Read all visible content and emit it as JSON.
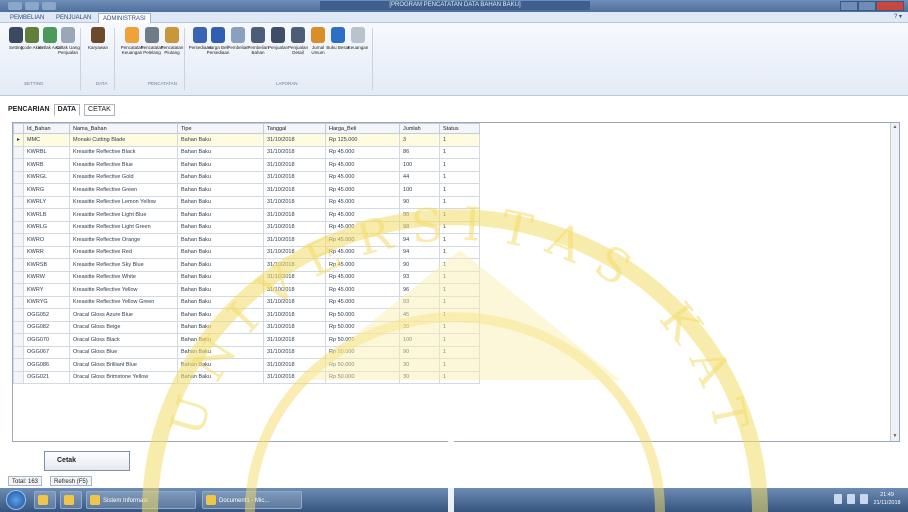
{
  "window": {
    "title": "[PROGRAM PENCATATAN DATA BAHAN BAKU]"
  },
  "menu": {
    "tabs": [
      "PEMBELIAN",
      "PENJUALAN",
      "ADMINISTRASI"
    ],
    "active": "ADMINISTRASI"
  },
  "ribbon": {
    "buttons": [
      {
        "label": "Setting",
        "icon": "user-gear-icon",
        "color": "#3b4a60"
      },
      {
        "label": "Kode Akun",
        "icon": "key-icon",
        "color": "#5f7f3a"
      },
      {
        "label": "Ketlak Awal",
        "icon": "gear-icon",
        "color": "#4a9b5a"
      },
      {
        "label": "Cetak Uang Penjualan",
        "icon": "printer-icon",
        "color": "#9aa7b8"
      },
      {
        "label": "Karyawan",
        "icon": "person-icon",
        "color": "#6b4a2e"
      },
      {
        "label": "Pencatatan Keuangan",
        "icon": "coin-icon",
        "color": "#f0a23a"
      },
      {
        "label": "Pencatatan Pelelang",
        "icon": "building-icon",
        "color": "#707b8a"
      },
      {
        "label": "Pencatatan Piutang",
        "icon": "book-icon",
        "color": "#c9973a"
      },
      {
        "label": "Persediaan",
        "icon": "chart-icon",
        "color": "#3a63b6"
      },
      {
        "label": "Harga Beli Persediaan",
        "icon": "chart-icon",
        "color": "#2f5eb3"
      },
      {
        "label": "Pembelian",
        "icon": "list-icon",
        "color": "#8aa0c0"
      },
      {
        "label": "Pembelian Bahan",
        "icon": "document-icon",
        "color": "#4c5d78"
      },
      {
        "label": "Penjualan",
        "icon": "document-icon",
        "color": "#3e4e66"
      },
      {
        "label": "Penjualan Detail",
        "icon": "document-icon",
        "color": "#4c5d78"
      },
      {
        "label": "Jurnal Umum",
        "icon": "pencil-icon",
        "color": "#d88f2a"
      },
      {
        "label": "Buku Besar",
        "icon": "books-icon",
        "color": "#2d6fc4"
      },
      {
        "label": "Keuangan",
        "icon": "ledger-icon",
        "color": "#b9c2cf"
      }
    ],
    "groups": [
      "SETTING",
      "DATA",
      "PENCATATAN",
      "LAPORAN"
    ]
  },
  "breadcrumb": {
    "section": "PENCARIAN",
    "tab_data": "DATA",
    "tab_cetak": "CETAK"
  },
  "grid": {
    "columns": [
      "Id_Bahan",
      "Nama_Bahan",
      "Tipe",
      "Tanggal",
      "Harga_Beli",
      "Jumlah",
      "Status"
    ],
    "rows": [
      [
        "MMC",
        "Monaki Cutting Blade",
        "Bahan Baku",
        "31/10/2018",
        "Rp 125.000",
        "3",
        "1"
      ],
      [
        "KWRBL",
        "Kreasitte Reflective Black",
        "Bahan Baku",
        "31/10/2018",
        "Rp 45.000",
        "86",
        "1"
      ],
      [
        "KWRB",
        "Kreasitte Reflective Blue",
        "Bahan Baku",
        "31/10/2018",
        "Rp 45.000",
        "100",
        "1"
      ],
      [
        "KWRGL",
        "Kreasitte Reflective Gold",
        "Bahan Baku",
        "31/10/2018",
        "Rp 45.000",
        "44",
        "1"
      ],
      [
        "KWRG",
        "Kreasitte Reflective Green",
        "Bahan Baku",
        "31/10/2018",
        "Rp 45.000",
        "100",
        "1"
      ],
      [
        "KWRLY",
        "Kreasitte Reflective Lemon Yellow",
        "Bahan Baku",
        "31/10/2018",
        "Rp 45.000",
        "90",
        "1"
      ],
      [
        "KWRLB",
        "Kreasitte Reflective Light Blue",
        "Bahan Baku",
        "31/10/2018",
        "Rp 45.000",
        "90",
        "1"
      ],
      [
        "KWRLG",
        "Kreasitte Reflective Light Green",
        "Bahan Baku",
        "31/10/2018",
        "Rp 45.000",
        "98",
        "1"
      ],
      [
        "KWRO",
        "Kreasitte Reflective Orange",
        "Bahan Baku",
        "31/10/2018",
        "Rp 45.000",
        "94",
        "1"
      ],
      [
        "KWRR",
        "Kreasitte Reflective Red",
        "Bahan Baku",
        "31/10/2018",
        "Rp 45.000",
        "94",
        "1"
      ],
      [
        "KWRSB",
        "Kreasitte Reflective Sky Blue",
        "Bahan Baku",
        "31/10/2018",
        "Rp 45.000",
        "90",
        "1"
      ],
      [
        "KWRW",
        "Kreasitte Reflective White",
        "Bahan Baku",
        "31/10/2018",
        "Rp 45.000",
        "93",
        "1"
      ],
      [
        "KWRY",
        "Kreasitte Reflective Yellow",
        "Bahan Baku",
        "31/10/2018",
        "Rp 45.000",
        "96",
        "1"
      ],
      [
        "KWRYG",
        "Kreasitte Reflective Yellow Green",
        "Bahan Baku",
        "31/10/2018",
        "Rp 45.000",
        "93",
        "1"
      ],
      [
        "OGG052",
        "Oracal Gloss Azure Blue",
        "Bahan Baku",
        "31/10/2018",
        "Rp 50.000",
        "45",
        "1"
      ],
      [
        "OGG082",
        "Oracal Gloss Beige",
        "Bahan Baku",
        "31/10/2018",
        "Rp 50.000",
        "30",
        "1"
      ],
      [
        "OGG070",
        "Oracal Gloss Black",
        "Bahan Baku",
        "31/10/2018",
        "Rp 50.000",
        "100",
        "1"
      ],
      [
        "OGG067",
        "Oracal Gloss Blue",
        "Bahan Baku",
        "31/10/2018",
        "Rp 50.000",
        "90",
        "1"
      ],
      [
        "OGG086",
        "Oracal Gloss Brilliant Blue",
        "Bahan Baku",
        "31/10/2018",
        "Rp 50.000",
        "30",
        "1"
      ],
      [
        "OGG021",
        "Oracal Gloss Brimstone Yellow",
        "Bahan Baku",
        "31/10/2018",
        "Rp 50.000",
        "30",
        "1"
      ]
    ]
  },
  "buttons": {
    "cetak": "Cetak"
  },
  "status": {
    "total": "Total: 163",
    "refresh": "Refresh (F5)"
  },
  "taskbar": {
    "items": [
      "Sistem Informasi",
      "Document1 - Mic..."
    ],
    "clock_time": "21:49",
    "clock_date": "21/11/2018"
  },
  "watermark": {
    "text": "UNIVERSITAS KATOLIK",
    "color": "#f3dc6a"
  }
}
